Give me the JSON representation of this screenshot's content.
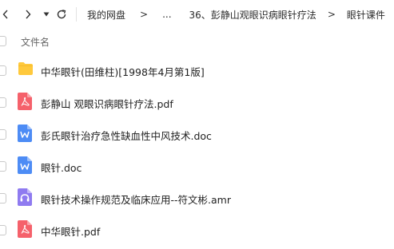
{
  "toolbar": {
    "back_icon": "chevron-left-icon",
    "forward_icon": "chevron-right-icon",
    "dropdown_icon": "caret-down-icon",
    "refresh_icon": "refresh-icon"
  },
  "breadcrumb": {
    "items": [
      "我的网盘",
      "...",
      "36、彭静山观眼识病眼针疗法",
      "眼针课件"
    ],
    "separator": ">"
  },
  "list_header": {
    "name_label": "文件名"
  },
  "files": [
    {
      "name": "中华眼针(田维柱)[1998年4月第1版]",
      "type": "folder",
      "icon": "folder-icon"
    },
    {
      "name": "彭静山 观眼识病眼针疗法.pdf",
      "type": "pdf",
      "icon": "pdf-icon"
    },
    {
      "name": "彭氏眼针治疗急性缺血性中风技术.doc",
      "type": "doc",
      "icon": "word-icon"
    },
    {
      "name": "眼针.doc",
      "type": "doc",
      "icon": "word-icon"
    },
    {
      "name": "眼针技术操作规范及临床应用--符文彬.amr",
      "type": "audio",
      "icon": "audio-icon"
    },
    {
      "name": "中华眼针.pdf",
      "type": "pdf",
      "icon": "pdf-icon"
    }
  ],
  "colors": {
    "folder": "#FFC93C",
    "pdf": "#F5616B",
    "word": "#4D8CF5",
    "audio": "#8F7BF0"
  }
}
